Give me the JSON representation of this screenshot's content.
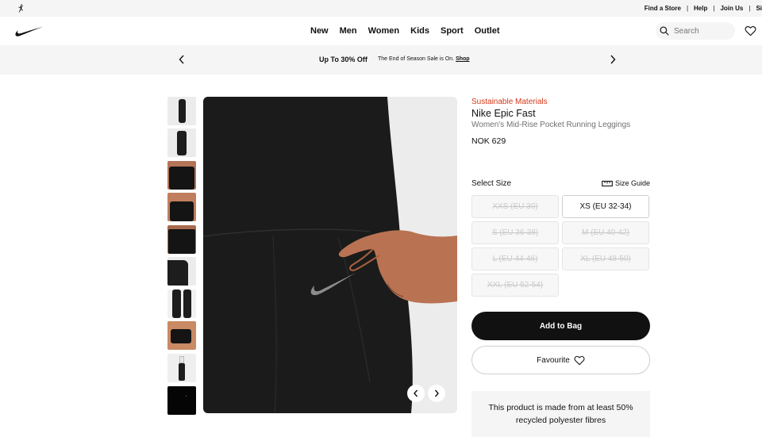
{
  "utility_bar": {
    "links": [
      "Find a Store",
      "Help",
      "Join Us",
      "Si"
    ],
    "icons": {
      "brand": "jordan-jumpman-icon"
    }
  },
  "nav": {
    "logo": "nike-swoosh-icon",
    "links": [
      "New",
      "Men",
      "Women",
      "Kids",
      "Sport",
      "Outlet"
    ],
    "search_placeholder": "Search",
    "icons": {
      "search": "search-icon",
      "favourites": "heart-icon"
    }
  },
  "promo": {
    "headline": "Up To 30% Off",
    "sub_text": "The End of Season Sale is On.",
    "shop_link": "Shop",
    "icons": {
      "prev": "chevron-left-icon",
      "next": "chevron-right-icon"
    }
  },
  "gallery": {
    "thumbnail_count": 10,
    "icons": {
      "prev": "chevron-left-icon",
      "next": "chevron-right-icon"
    }
  },
  "product": {
    "badge": "Sustainable Materials",
    "name": "Nike Epic Fast",
    "subtitle": "Women's Mid-Rise Pocket Running Leggings",
    "price": "NOK 629",
    "select_size_label": "Select Size",
    "size_guide_label": "Size Guide",
    "size_guide_icon": "ruler-icon",
    "sizes": [
      {
        "label": "XXS (EU 30)",
        "available": false
      },
      {
        "label": "XS (EU 32-34)",
        "available": true
      },
      {
        "label": "S (EU 36-38)",
        "available": false
      },
      {
        "label": "M (EU 40-42)",
        "available": false
      },
      {
        "label": "L (EU 44-46)",
        "available": false
      },
      {
        "label": "XL (EU 48-50)",
        "available": false
      },
      {
        "label": "XXL (EU 52-54)",
        "available": false
      }
    ],
    "add_to_bag_label": "Add to Bag",
    "favourite_label": "Favourite",
    "favourite_icon": "heart-icon",
    "sustainability_note": "This product is made from at least 50% recycled polyester fibres"
  },
  "colors": {
    "accent_red": "#d33918",
    "black": "#111111",
    "light_gray": "#f5f5f5",
    "muted_text": "#707072"
  }
}
